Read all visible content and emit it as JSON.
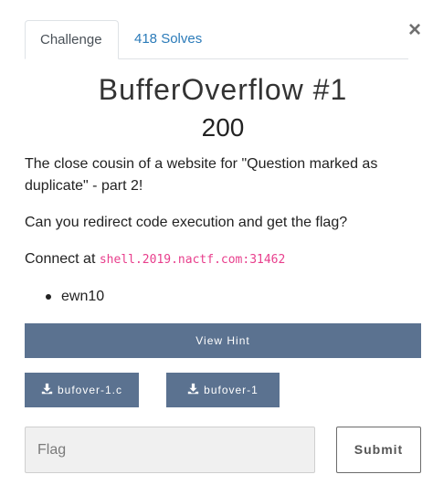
{
  "modal": {
    "close_glyph": "×"
  },
  "tabs": {
    "challenge": "Challenge",
    "solves": "418 Solves"
  },
  "challenge": {
    "name": "BufferOverflow #1",
    "points": "200",
    "description_line1": "The close cousin of a website for \"Question marked as duplicate\" - part 2!",
    "description_line2": "Can you redirect code execution and get the flag?",
    "connect_prefix": "Connect at",
    "connect_address": "shell.2019.nactf.com:31462",
    "author": "ewn10"
  },
  "actions": {
    "hint_label": "View Hint",
    "file1_label": "bufover-1.c",
    "file2_label": "bufover-1",
    "flag_placeholder": "Flag",
    "flag_value": "",
    "submit_label": "Submit"
  },
  "icons": {
    "download": "download-icon",
    "close": "close-icon"
  },
  "colors": {
    "button_bg": "#5b7290",
    "link": "#2b7bb9",
    "code": "#e83e8c"
  }
}
